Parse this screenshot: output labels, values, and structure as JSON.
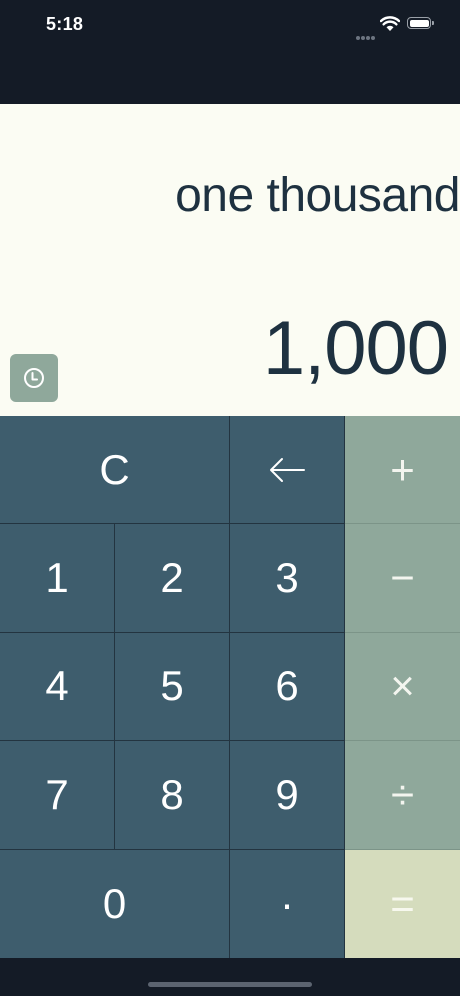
{
  "status_bar": {
    "time": "5:18"
  },
  "display": {
    "words": "one thousand",
    "number": "1,000"
  },
  "keypad": {
    "clear": "C",
    "backspace": "←",
    "plus": "+",
    "minus": "−",
    "multiply": "×",
    "divide": "÷",
    "equals": "=",
    "decimal": "·",
    "digits": [
      "0",
      "1",
      "2",
      "3",
      "4",
      "5",
      "6",
      "7",
      "8",
      "9"
    ]
  },
  "colors": {
    "status_bg": "#141b26",
    "display_bg": "#fbfcf3",
    "key_bg": "#3e5d6d",
    "operator_bg": "#8fa89b",
    "equals_bg": "#d5dcbd",
    "text_dark": "#1e3140"
  },
  "icons": {
    "history": "clock-icon",
    "backspace": "arrow-left-icon"
  }
}
